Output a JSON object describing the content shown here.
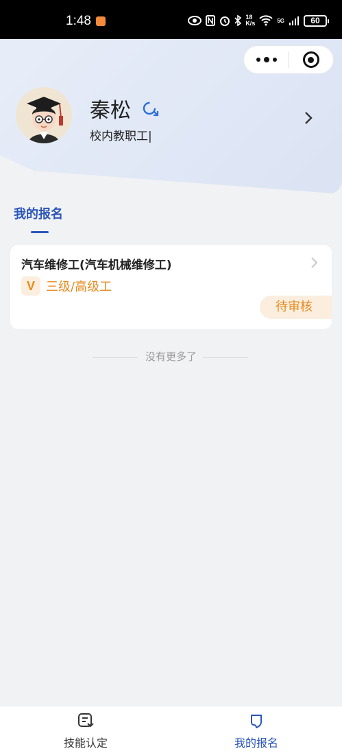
{
  "status_bar": {
    "time": "1:48",
    "network_speed_top": "18",
    "network_speed_bottom": "K/s",
    "signal_label": "5G",
    "battery": "60"
  },
  "profile": {
    "name": "秦松",
    "role": "校内教职工|"
  },
  "section": {
    "title": "我的报名"
  },
  "registrations": [
    {
      "title": "汽车维修工(汽车机械维修工)",
      "badge": "V",
      "level": "三级/高级工",
      "status": "待审核"
    }
  ],
  "list_footer": "没有更多了",
  "tabbar": {
    "items": [
      {
        "label": "技能认定",
        "active": false
      },
      {
        "label": "我的报名",
        "active": true
      }
    ]
  },
  "colors": {
    "accent": "#2a55b9",
    "warning": "#e68a1f",
    "warning_bg": "#fbeede"
  }
}
